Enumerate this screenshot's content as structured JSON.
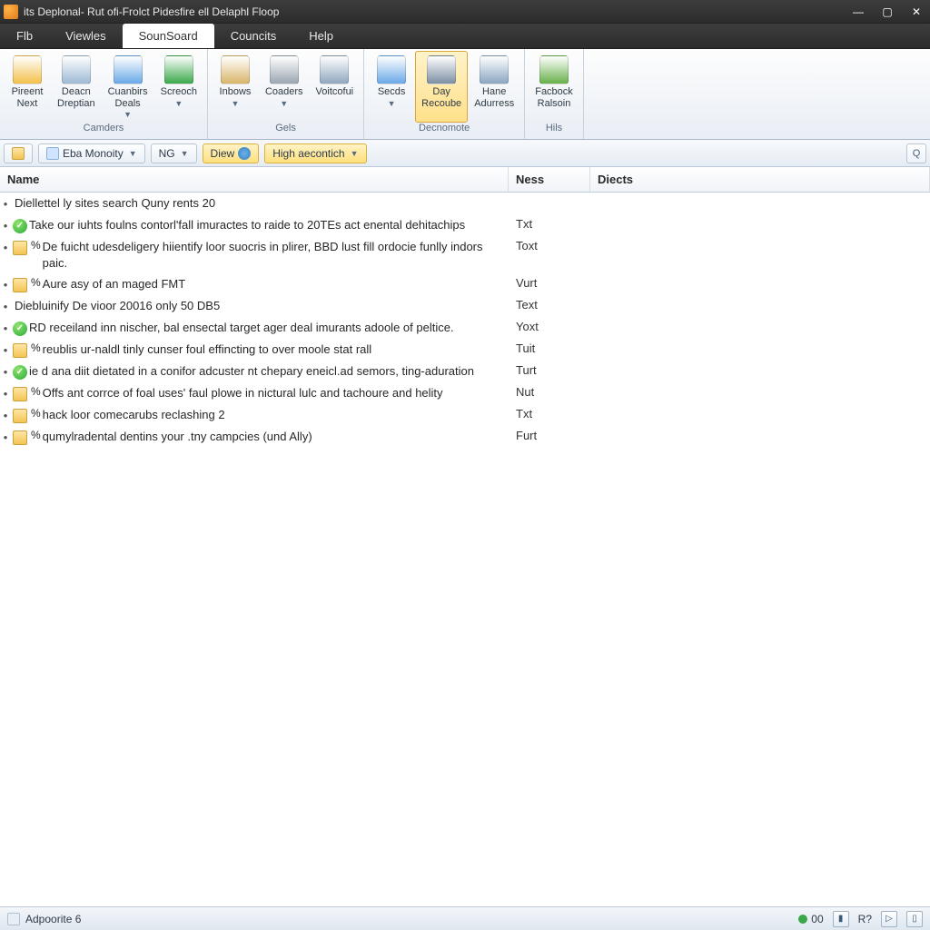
{
  "window": {
    "title": "its Deplonal- Rut ofi-Frolct Pidesfire ell Delaphl Floop"
  },
  "menu": {
    "items": [
      "Flb",
      "Viewles",
      "SounSoard",
      "Councits",
      "Help"
    ],
    "active_index": 2
  },
  "ribbon": {
    "groups": [
      {
        "label": "Camders",
        "buttons": [
          {
            "label": "Pireent\nNext",
            "icon": "#f3c04a",
            "dropdown": false
          },
          {
            "label": "Deacn\nDreptian",
            "icon": "#9db9d4",
            "dropdown": false
          },
          {
            "label": "Cuanbirs\nDeals",
            "icon": "#6aa9e8",
            "dropdown": true
          },
          {
            "label": "Screoch",
            "icon": "#3aa84a",
            "dropdown": true
          }
        ]
      },
      {
        "label": "Gels",
        "buttons": [
          {
            "label": "Inbows",
            "icon": "#d9b56a",
            "dropdown": true
          },
          {
            "label": "Coaders",
            "icon": "#9aa6b2",
            "dropdown": true
          },
          {
            "label": "Voitcofui",
            "icon": "#8fa7bf",
            "dropdown": false
          }
        ]
      },
      {
        "label": "Decnomote",
        "buttons": [
          {
            "label": "Secds",
            "icon": "#6aa9e8",
            "dropdown": true
          },
          {
            "label": "Day\nRecoube",
            "icon": "#7d8fa3",
            "dropdown": false,
            "selected": true
          },
          {
            "label": "Hane\nAdurress",
            "icon": "#8aa6c2",
            "dropdown": false
          }
        ]
      },
      {
        "label": "Hils",
        "buttons": [
          {
            "label": "Facbock\nRalsoin",
            "icon": "#67b04a",
            "dropdown": false
          }
        ]
      }
    ]
  },
  "filterbar": {
    "btn1": {
      "label": "Eba Monoity"
    },
    "btn2": {
      "label": "NG"
    },
    "btn3": {
      "label": "Diew"
    },
    "btn4": {
      "label": "High aecontich"
    },
    "right_badge": "Q"
  },
  "columns": {
    "name": "Name",
    "ness": "Ness",
    "diects": "Diects"
  },
  "rows": [
    {
      "icon": "none",
      "pct": "",
      "text": "Diellettel ly sites search Quny rents 20",
      "ness": ""
    },
    {
      "icon": "check",
      "pct": "",
      "text": "Take our iuhts foulns contorl'fall imuractes to raide to 20TEs act enental dehitachips",
      "ness": "Txt"
    },
    {
      "icon": "folder",
      "pct": "%",
      "text": "De fuicht udesdeligery hiientify loor suocris in plirer, BBD lust fill ordocie funlly indors paic.",
      "ness": "Toxt"
    },
    {
      "icon": "folder",
      "pct": "%",
      "text": "Aure asy of an maged FMT",
      "ness": "Vurt"
    },
    {
      "icon": "none",
      "pct": "",
      "text": "Diebluinify De vioor 20016 only 50 DB5",
      "ness": "Text"
    },
    {
      "icon": "check",
      "pct": "",
      "text": "RD receiland inn nischer, bal ensectal target ager deal imurants adoole of peltice.",
      "ness": "Yoxt"
    },
    {
      "icon": "folder",
      "pct": "%",
      "text": "reublis ur-naldl tinly cunser foul effincting to over moole stat rall",
      "ness": "Tuit"
    },
    {
      "icon": "check",
      "pct": "",
      "text": "ie d ana diit dietated in a conifor adcuster nt chepary eneicl.ad semors, ting-aduration",
      "ness": "Turt"
    },
    {
      "icon": "folder",
      "pct": "%",
      "text": "Offs ant corrce of foal uses' faul plowe in nictural lulc and tachoure and helity",
      "ness": "Nut"
    },
    {
      "icon": "folder",
      "pct": "%",
      "text": "hack loor comecarubs reclashing 2",
      "ness": "Txt"
    },
    {
      "icon": "folder",
      "pct": "%",
      "text": "qumylradental dentins your .tny campcies (und Ally)",
      "ness": "Furt"
    }
  ],
  "status": {
    "left": "Adpoorite 6",
    "chip1": {
      "label": "00",
      "color": "#3aa84a"
    },
    "chip2": {
      "label": "R?",
      "color": "#5a8fd0"
    }
  }
}
